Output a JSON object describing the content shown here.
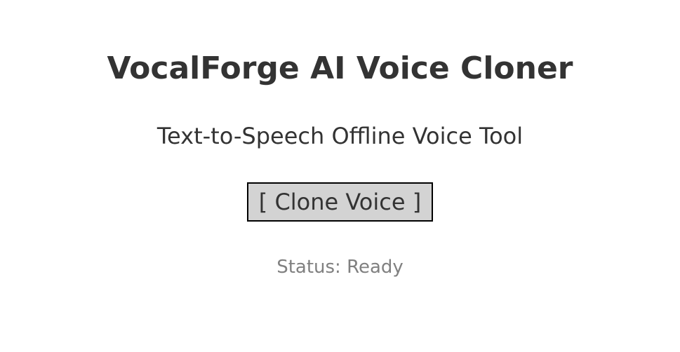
{
  "app": {
    "title": "VocalForge AI Voice Cloner",
    "subtitle": "Text-to-Speech Offline Voice Tool"
  },
  "actions": {
    "clone_label": "[ Clone Voice ]"
  },
  "status": {
    "text": "Status: Ready"
  },
  "colors": {
    "background": "#ffffff",
    "text": "#333333",
    "button_bg": "#d3d3d3",
    "button_border": "#000000",
    "status_text": "#808080"
  }
}
